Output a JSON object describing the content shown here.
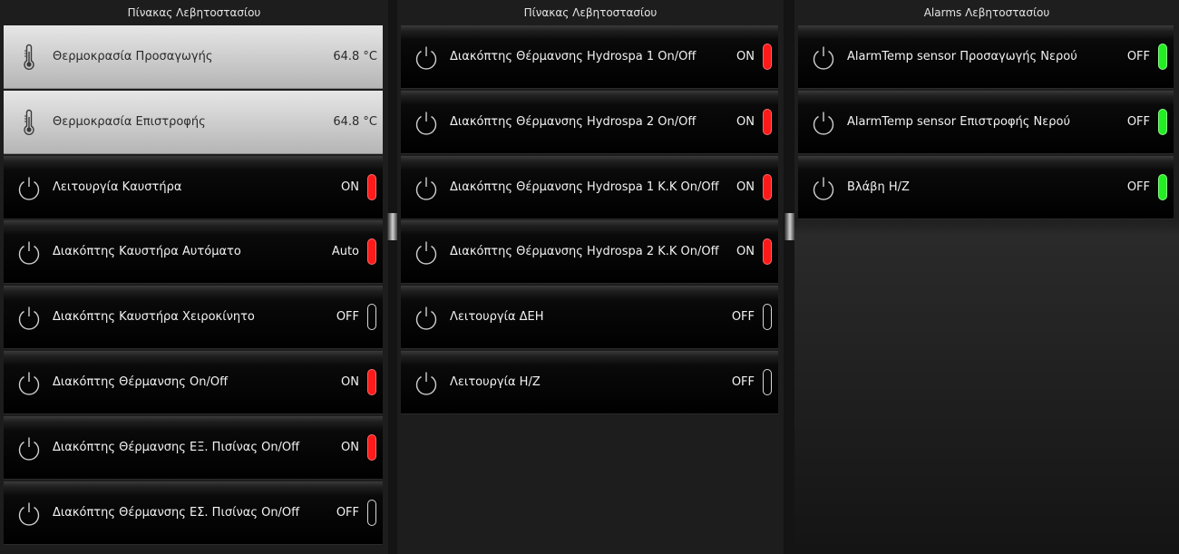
{
  "colors": {
    "on": "#ff1a1a",
    "alarm_ok": "#22ee22",
    "off_outline": "#d8d8d8"
  },
  "panels": [
    {
      "title": "Πίνακας Λεβητοστασίου",
      "rows": [
        {
          "type": "sensor",
          "icon": "thermometer-icon",
          "label": "Θερμοκρασία Προσαγωγής",
          "value": "64.8 °C"
        },
        {
          "type": "sensor",
          "icon": "thermometer-icon",
          "label": "Θερμοκρασία Επιστροφής",
          "value": "64.8 °C"
        },
        {
          "type": "switch",
          "icon": "power-icon",
          "label": "Λειτουργία Καυστήρα",
          "value": "ON",
          "state": "red"
        },
        {
          "type": "switch",
          "icon": "power-icon",
          "label": "Διακόπτης Καυστήρα Αυτόματο",
          "value": "Auto",
          "state": "red"
        },
        {
          "type": "switch",
          "icon": "power-icon",
          "label": "Διακόπτης Καυστήρα Χειροκίνητο",
          "value": "OFF",
          "state": "off"
        },
        {
          "type": "switch",
          "icon": "power-icon",
          "label": "Διακόπτης Θέρμανσης On/Off",
          "value": "ON",
          "state": "red"
        },
        {
          "type": "switch",
          "icon": "power-icon",
          "label": "Διακόπτης Θέρμανσης ΕΞ. Πισίνας On/Off",
          "value": "ON",
          "state": "red"
        },
        {
          "type": "switch",
          "icon": "power-icon",
          "label": "Διακόπτης Θέρμανσης ΕΣ. Πισίνας On/Off",
          "value": "OFF",
          "state": "off"
        }
      ]
    },
    {
      "title": "Πίνακας Λεβητοστασίου",
      "rows": [
        {
          "type": "switch",
          "icon": "power-icon",
          "label": "Διακόπτης Θέρμανσης Hydrospa 1 On/Off",
          "value": "ON",
          "state": "red"
        },
        {
          "type": "switch",
          "icon": "power-icon",
          "label": "Διακόπτης Θέρμανσης Hydrospa 2 On/Off",
          "value": "ON",
          "state": "red"
        },
        {
          "type": "switch",
          "icon": "power-icon",
          "label": "Διακόπτης Θέρμανσης Hydrospa 1 Κ.Κ On/Off",
          "value": "ON",
          "state": "red"
        },
        {
          "type": "switch",
          "icon": "power-icon",
          "label": "Διακόπτης Θέρμανσης Hydrospa 2 Κ.Κ On/Off",
          "value": "ON",
          "state": "red"
        },
        {
          "type": "switch",
          "icon": "power-icon",
          "label": "Λειτουργία ΔΕΗ",
          "value": "OFF",
          "state": "off"
        },
        {
          "type": "switch",
          "icon": "power-icon",
          "label": "Λειτουργία Η/Ζ",
          "value": "OFF",
          "state": "off"
        }
      ]
    },
    {
      "title": "Alarms Λεβητοστασίου",
      "rows": [
        {
          "type": "switch",
          "icon": "power-icon",
          "label": "AlarmTemp sensor Προσαγωγής Νερού",
          "value": "OFF",
          "state": "green"
        },
        {
          "type": "switch",
          "icon": "power-icon",
          "label": "AlarmTemp sensor Επιστροφής Νερού",
          "value": "OFF",
          "state": "green"
        },
        {
          "type": "switch",
          "icon": "power-icon",
          "label": "Βλάβη Η/Ζ",
          "value": "OFF",
          "state": "green"
        }
      ]
    }
  ]
}
